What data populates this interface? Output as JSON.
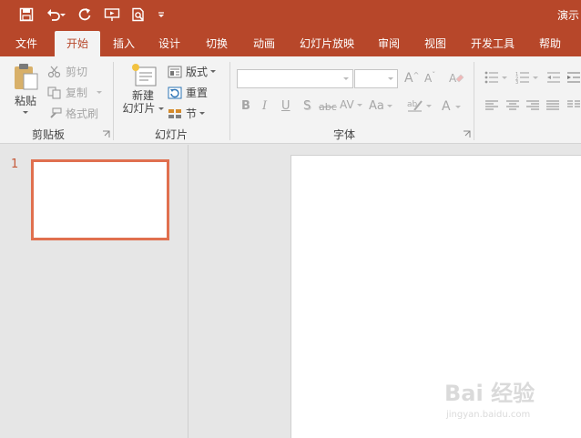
{
  "title_bar": {
    "document_title": "演示",
    "qat": [
      {
        "icon": "save-icon"
      },
      {
        "icon": "undo-icon"
      },
      {
        "icon": "redo-icon"
      },
      {
        "icon": "start-slideshow-icon"
      },
      {
        "icon": "print-preview-icon"
      },
      {
        "icon": "customize-qat-icon"
      }
    ]
  },
  "tabs": [
    "文件",
    "开始",
    "插入",
    "设计",
    "切换",
    "动画",
    "幻灯片放映",
    "审阅",
    "视图",
    "开发工具",
    "帮助"
  ],
  "active_tab": "开始",
  "ribbon": {
    "clipboard": {
      "label": "剪贴板",
      "paste": "粘贴",
      "cut": "剪切",
      "copy": "复制",
      "format_painter": "格式刷"
    },
    "slides": {
      "label": "幻灯片",
      "new_slide_line1": "新建",
      "new_slide_line2": "幻灯片",
      "layout": "版式",
      "reset": "重置",
      "section": "节"
    },
    "font": {
      "label": "字体",
      "font_name_value": "",
      "font_size_value": "",
      "bold": "B",
      "italic": "I",
      "underline": "U",
      "shadow": "S",
      "strikethrough": "abc",
      "spacing": "AV",
      "change_case": "Aa",
      "increase_size": "A",
      "decrease_size": "A",
      "font_color": "A"
    }
  },
  "slides_pane": {
    "slide_number": "1"
  },
  "watermark": {
    "main": "Bai 经验",
    "sub": "jingyan.baidu.com"
  },
  "colors": {
    "accent": "#b7472a",
    "thumb_border": "#e0704f",
    "ribbon_bg": "#f3f3f3",
    "workspace_bg": "#e6e6e6"
  }
}
